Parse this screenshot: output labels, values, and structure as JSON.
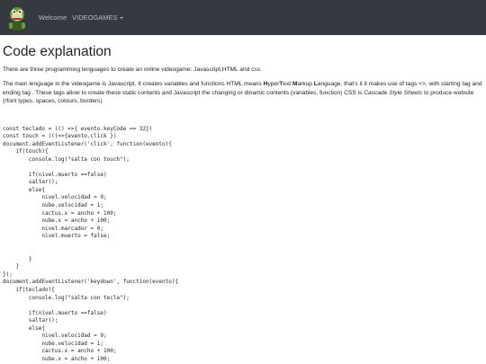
{
  "nav": {
    "welcome": "Welcome",
    "videogames": "VIDEOGAMES"
  },
  "page": {
    "title": "Code explanation",
    "intro": "There are three programming lenguages to create an online videogame: Javascript,HTML and css.",
    "desc_p1": "The main lenguage in the videogame is Javascript. It creates variables and functions HTML means ",
    "desc_h": "H",
    "desc_p2": "yper",
    "desc_t": "T",
    "desc_p3": "ext ",
    "desc_m": "M",
    "desc_p4": "arkup ",
    "desc_l": "L",
    "desc_p5": "anguage, that's it it makes use of tags <>, with starting tag and ending tag . These tags allow to create these static contents and Javascript the changing or dinamic contents (variables, function) CSS is ",
    "desc_css": "Cascade Style Sheets",
    "desc_p6": " to produce website (rfont types, spaces, colours, borders)"
  },
  "code": "const teclado = (() =>{ evento.keyCode == 32})\nconst touch = (()=>{evento.click })\ndocument.addEventListener('click', function(evento){\n    if(touch){\n        console.log(\"salta con touch\");\n\n        if(nivel.muerto ==false)\n        saltar();\n        else{\n            nivel.velocidad = 9;\n            nube.velocidad = 1;\n            cactus.x = ancho + 100;\n            nube.x = ancho + 100;\n            nivel.marcador = 0;\n            nivel.muerto = false;\n\n\n        }\n    }\n});\ndocument.addEventListener('keydown', function(evento){\n    if(teclado){\n        console.log(\"salta con tecla\");\n\n        if(nivel.muerto ==false)\n        saltar();\n        else{\n            nivel.velocidad = 9;\n            nube.velocidad = 1;\n            cactus.x = ancho + 100;\n            nube.x = ancho + 100;"
}
